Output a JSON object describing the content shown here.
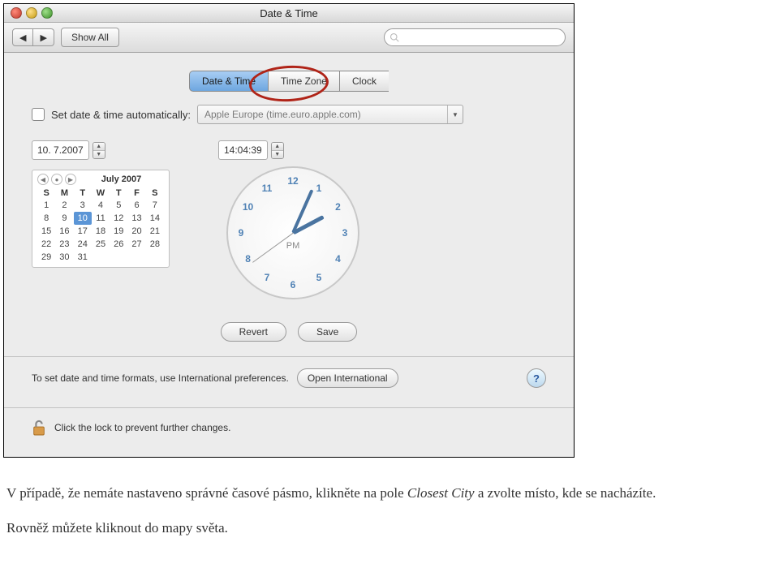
{
  "window": {
    "title": "Date & Time"
  },
  "toolbar": {
    "show_all": "Show All"
  },
  "tabs": {
    "date_time": "Date & Time",
    "time_zone": "Time Zone",
    "clock": "Clock"
  },
  "auto": {
    "label": "Set date & time automatically:",
    "server": "Apple Europe (time.euro.apple.com)"
  },
  "date": {
    "value": "10. 7.2007"
  },
  "time": {
    "value": "14:04:39"
  },
  "calendar": {
    "month": "July 2007",
    "days": [
      "S",
      "M",
      "T",
      "W",
      "T",
      "F",
      "S"
    ],
    "cells": [
      1,
      2,
      3,
      4,
      5,
      6,
      7,
      8,
      9,
      10,
      11,
      12,
      13,
      14,
      15,
      16,
      17,
      18,
      19,
      20,
      21,
      22,
      23,
      24,
      25,
      26,
      27,
      28,
      29,
      30,
      31
    ],
    "selected": 10
  },
  "clock": {
    "pm": "PM",
    "numerals": [
      12,
      1,
      2,
      3,
      4,
      5,
      6,
      7,
      8,
      9,
      10,
      11
    ]
  },
  "buttons": {
    "revert": "Revert",
    "save": "Save",
    "open_intl": "Open International"
  },
  "footer": {
    "intl_text": "To set date and time formats, use International preferences.",
    "lock_text": "Click the lock to prevent further changes."
  },
  "article": {
    "p1a": "V případě, že nemáte nastaveno správné časové pásmo, klikněte na pole ",
    "p1i": "Closest City",
    "p1b": " a zvolte místo, kde se nacházíte.",
    "p2": "Rovněž můžete kliknout do mapy světa."
  }
}
